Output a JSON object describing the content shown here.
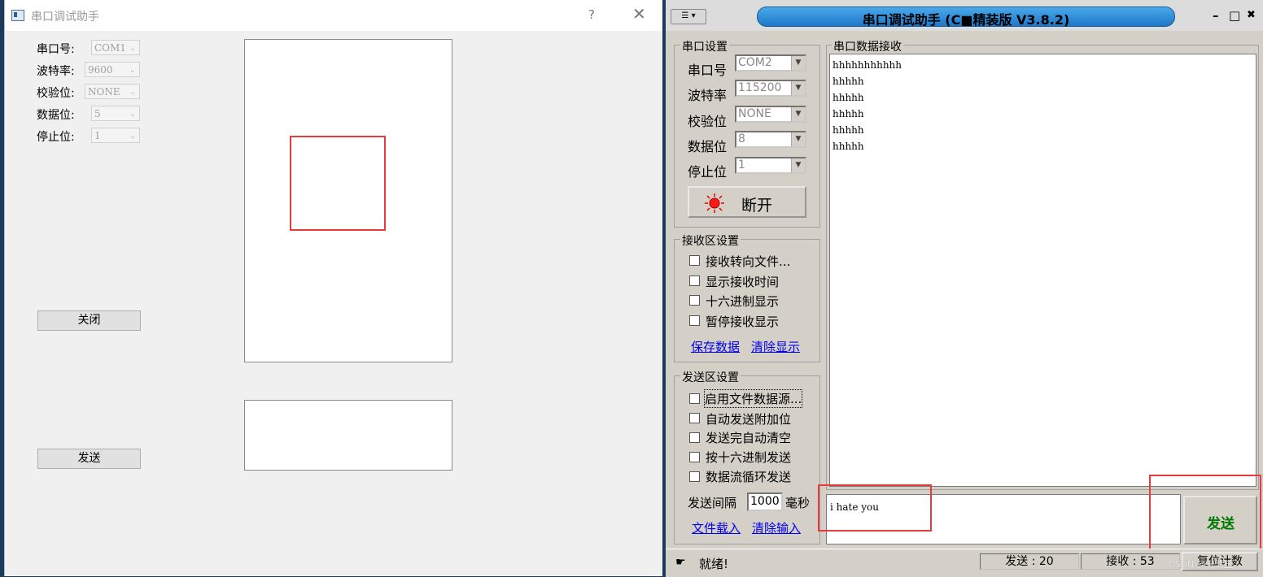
{
  "left": {
    "title": "串口调试助手",
    "help": "?",
    "close": "✕",
    "fields": [
      {
        "label": "串口号:",
        "value": "COM1"
      },
      {
        "label": "波特率:",
        "value": "9600"
      },
      {
        "label": "校验位:",
        "value": "NONE"
      },
      {
        "label": "数据位:",
        "value": "5"
      },
      {
        "label": "停止位:",
        "value": "1"
      }
    ],
    "close_button": "关闭",
    "send_button": "发送"
  },
  "right": {
    "title": "串口调试助手 (C■精装版 V3.8.2)",
    "sys_menu": "▾",
    "ctl_min": "–",
    "ctl_max": "□",
    "ctl_close": "✖",
    "serial_group": "串口设置",
    "fields": [
      {
        "label": "串口号",
        "value": "COM2"
      },
      {
        "label": "波特率",
        "value": "115200"
      },
      {
        "label": "校验位",
        "value": "NONE"
      },
      {
        "label": "数据位",
        "value": "8"
      },
      {
        "label": "停止位",
        "value": "1"
      }
    ],
    "disconnect_button": "断开",
    "recv_group": "接收区设置",
    "recv_options": [
      "接收转向文件...",
      "显示接收时间",
      "十六进制显示",
      "暂停接收显示"
    ],
    "save_data": "保存数据",
    "clear_display": "清除显示",
    "send_group": "发送区设置",
    "send_options": [
      "启用文件数据源...",
      "自动发送附加位",
      "发送完自动清空",
      "按十六进制发送",
      "数据流循环发送"
    ],
    "interval_label": "发送间隔",
    "interval_value": "1000",
    "interval_unit": "毫秒",
    "file_load": "文件载入",
    "clear_input": "清除输入",
    "recv_data_group": "串口数据接收",
    "recv_lines": [
      "hhhhhhhhhhh",
      "hhhhh",
      "hhhhh",
      "hhhhh",
      "hhhhh",
      "hhhhh"
    ],
    "send_text": "i hate you",
    "send_button": "发送",
    "status_ready": "就绪!",
    "status_sent": "发送 : 20",
    "status_recv": "接收 : 53",
    "reset_count": "复位计数",
    "watermark": "CSDN @一淸丘"
  },
  "colors": {
    "red_highlight": "#e63b3b",
    "title_capsule": "#2e8ad8",
    "send_green": "#007a00",
    "link_blue": "#0000ee"
  }
}
